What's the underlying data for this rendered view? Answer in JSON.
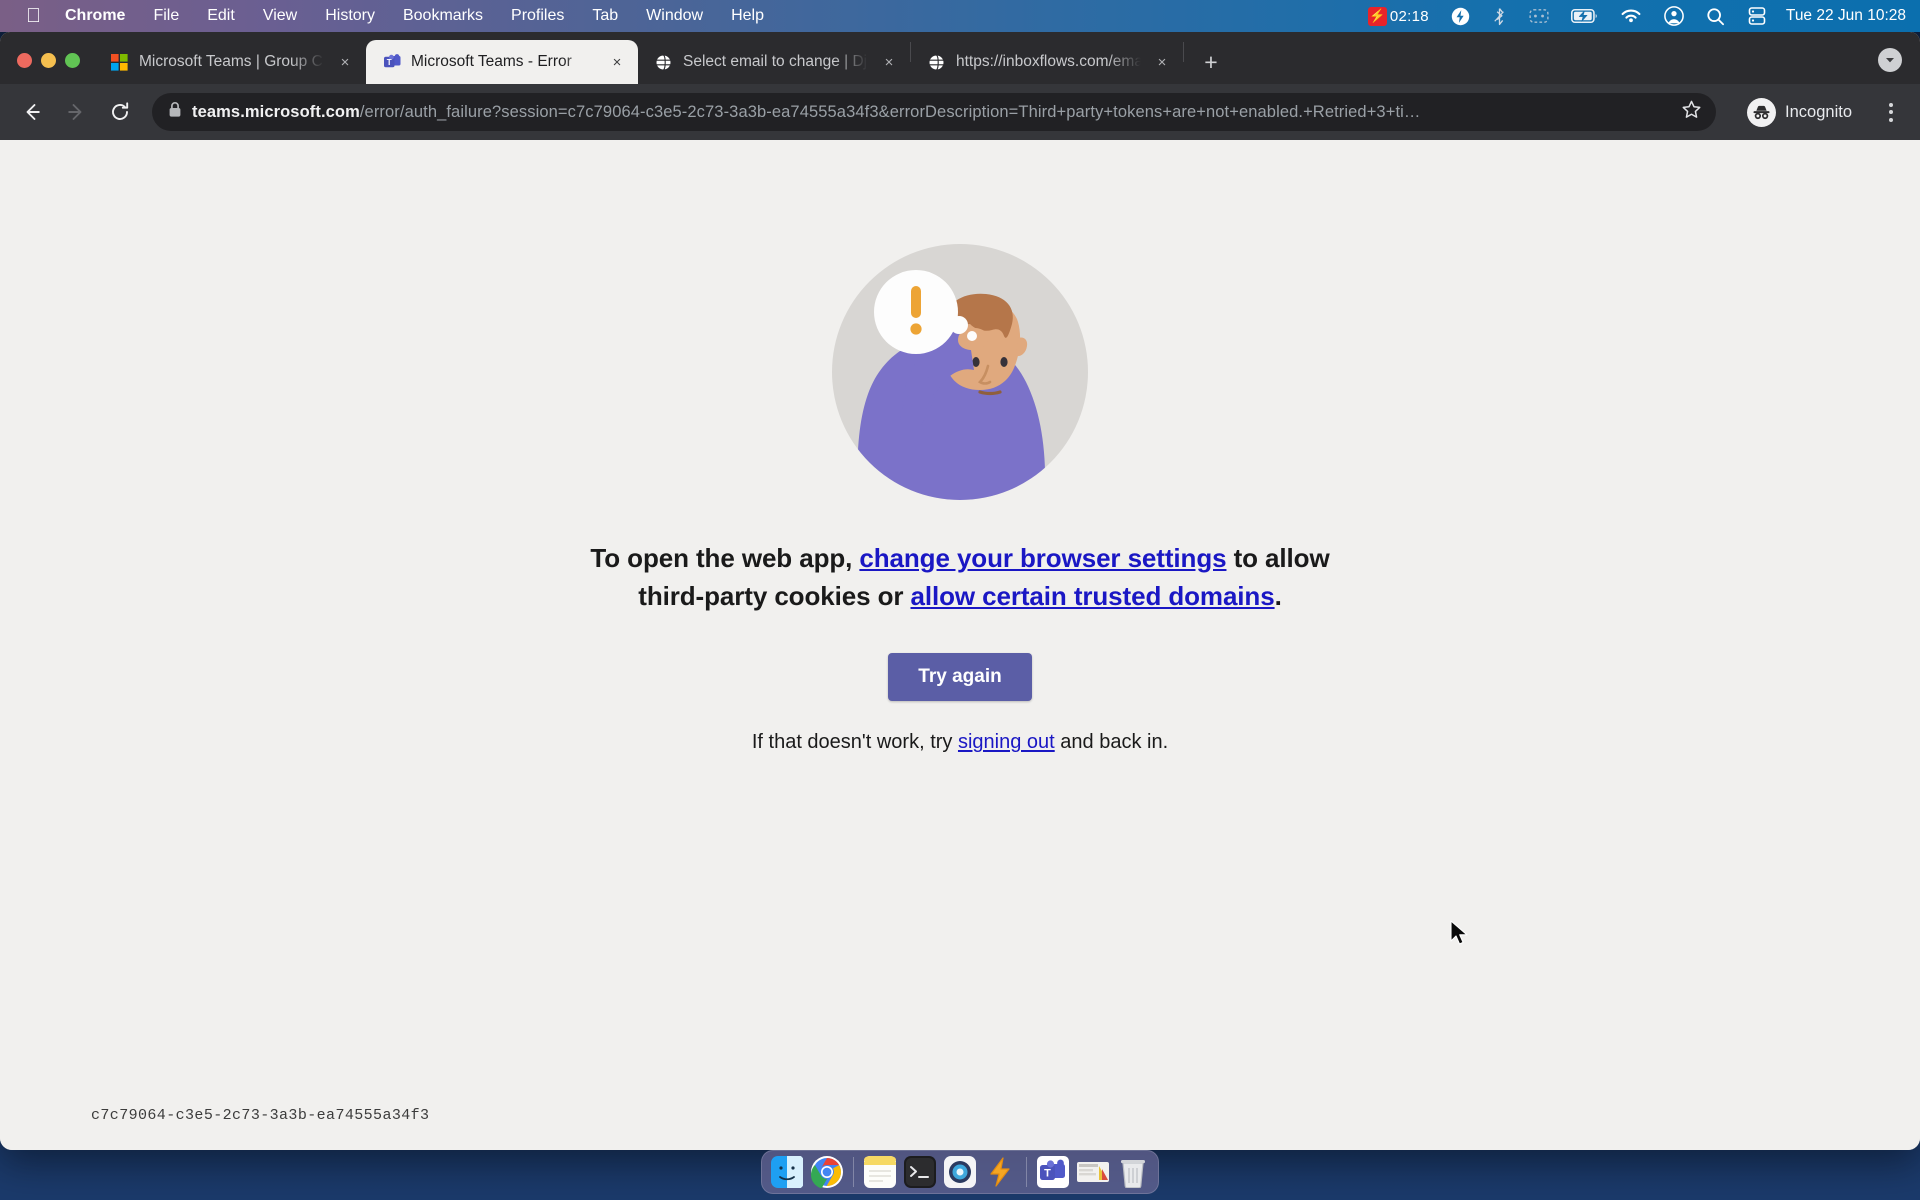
{
  "menubar": {
    "apple_icon": "apple-logo-icon",
    "items": [
      {
        "label": "Chrome",
        "bold": true
      },
      {
        "label": "File",
        "bold": false
      },
      {
        "label": "Edit",
        "bold": false
      },
      {
        "label": "View",
        "bold": false
      },
      {
        "label": "History",
        "bold": false
      },
      {
        "label": "Bookmarks",
        "bold": false
      },
      {
        "label": "Profiles",
        "bold": false
      },
      {
        "label": "Tab",
        "bold": false
      },
      {
        "label": "Window",
        "bold": false
      },
      {
        "label": "Help",
        "bold": false
      }
    ],
    "recording_time": "02:18",
    "status_icons": [
      "bolt-icon",
      "bluetooth-icon",
      "control-center-icon",
      "battery-charging-icon",
      "wifi-icon",
      "user-account-icon",
      "search-icon",
      "display-icon"
    ],
    "clock": "Tue 22 Jun  10:28"
  },
  "browser": {
    "tabs": [
      {
        "title": "Microsoft Teams | Group Chat,",
        "favicon": "microsoft-logo-icon",
        "active": false
      },
      {
        "title": "Microsoft Teams - Error",
        "favicon": "teams-icon",
        "active": true
      },
      {
        "title": "Select email to change | Djang",
        "favicon": "globe-icon",
        "active": false
      },
      {
        "title": "https://inboxflows.com/emails/",
        "favicon": "globe-icon",
        "active": false
      }
    ],
    "new_tab_label": "+",
    "close_label": "×",
    "toolbar": {
      "back_icon": "back-arrow-icon",
      "forward_icon": "forward-arrow-icon",
      "reload_icon": "reload-icon",
      "lock_icon": "lock-icon",
      "url_domain": "teams.microsoft.com",
      "url_path": "/error/auth_failure?session=c7c79064-c3e5-2c73-3a3b-ea74555a34f3&errorDescription=Third+party+tokens+are+not+enabled.+Retried+3+ti…",
      "bookmark_icon": "star-icon",
      "profile_label": "Incognito",
      "menu_icon": "kebab-menu-icon"
    }
  },
  "page": {
    "illustration": "confused-person-illustration",
    "message_prefix": "To open the web app, ",
    "link_browser_settings": "change your browser settings",
    "message_middle": " to allow third-party cookies or ",
    "link_trusted_domains": "allow certain trusted domains",
    "message_suffix": ".",
    "try_again_label": "Try again",
    "subtext_prefix": "If that doesn't work, try ",
    "link_signing_out": "signing out",
    "subtext_suffix": " and back in.",
    "session_id": "c7c79064-c3e5-2c73-3a3b-ea74555a34f3",
    "accent_color": "#5b5ea6",
    "link_color": "#1a17c4",
    "background_color": "#f1f0ee"
  },
  "dock": {
    "items": [
      {
        "name": "finder",
        "running": true
      },
      {
        "name": "chrome",
        "running": true
      },
      {
        "name": "notes",
        "running": true
      },
      {
        "name": "terminal",
        "running": true
      },
      {
        "name": "preview",
        "running": true
      },
      {
        "name": "lightning-app",
        "running": true
      },
      {
        "name": "teams",
        "running": false
      },
      {
        "name": "screenshot-thumbnail",
        "running": false
      },
      {
        "name": "trash",
        "running": false
      }
    ]
  }
}
